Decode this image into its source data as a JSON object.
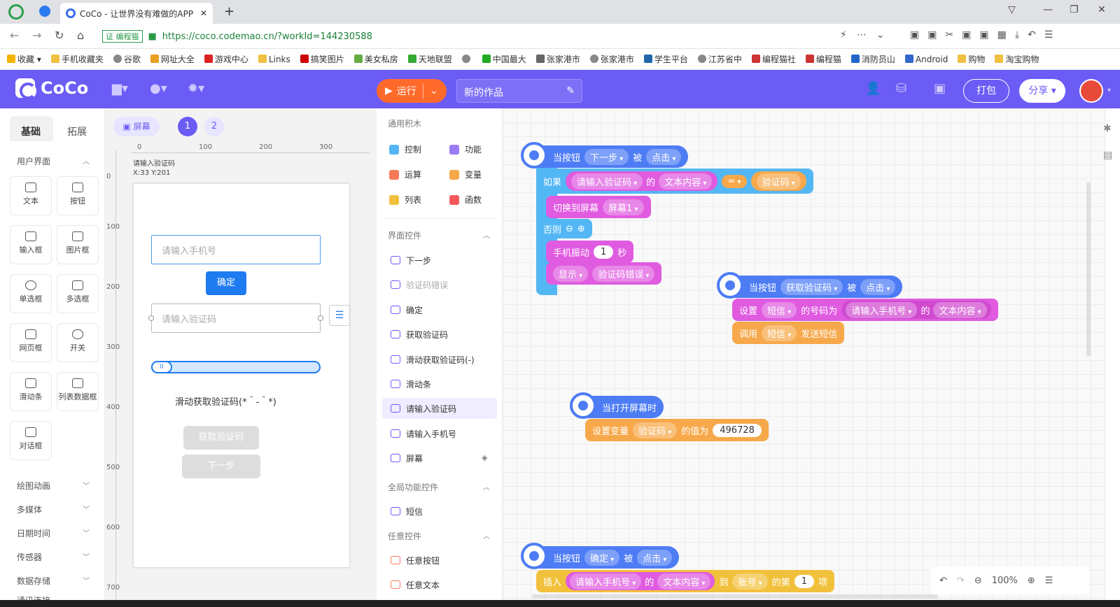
{
  "browser": {
    "tab_title": "CoCo - 让世界没有难做的APP",
    "url": "https://coco.codemao.cn/?workId=144230588",
    "url_badge": "证 编程猫",
    "bookmarks": [
      "收藏",
      "手机收藏夹",
      "谷歌",
      "网址大全",
      "游戏中心",
      "Links",
      "搞笑图片",
      "美女私房",
      "天地联盟",
      "",
      "中国最大",
      "张家港市",
      "张家港市",
      "学生平台",
      "江苏省中",
      "编程猫社",
      "编程猫",
      "消防员山",
      "Android",
      "购物",
      "淘宝购物"
    ]
  },
  "header": {
    "logo": "CoCo",
    "run_label": "运行",
    "work_name": "新的作品",
    "pack_label": "打包",
    "share_label": "分享"
  },
  "left": {
    "tabs": [
      "基础",
      "拓展"
    ],
    "section_ui": "用户界面",
    "components": [
      "文本",
      "按钮",
      "输入框",
      "图片框",
      "单选框",
      "多选框",
      "网页框",
      "开关",
      "滑动条",
      "列表数据框",
      "对话框"
    ],
    "sections": [
      "绘图动画",
      "多媒体",
      "日期时间",
      "传感器",
      "数据存储",
      "通讯连接"
    ]
  },
  "stage": {
    "screen_btn": "屏幕",
    "pages": [
      "1",
      "2"
    ],
    "ruler": [
      "0",
      "100",
      "200",
      "300"
    ],
    "vruler": [
      "0",
      "100",
      "200",
      "300",
      "400",
      "500",
      "600",
      "700"
    ],
    "selected_name": "请输入验证码",
    "coord": "X:33 Y:201",
    "phone_placeholder": "请输入手机号",
    "ok_label": "确定",
    "code_placeholder": "请输入验证码",
    "slider_label": "滑动获取验证码(*＾-＾*)",
    "get_code_label": "获取验证码",
    "next_label": "下一步"
  },
  "palette": {
    "title": "通用积木",
    "cats": [
      "控制",
      "功能",
      "运算",
      "变量",
      "列表",
      "函数"
    ],
    "ui_section": "界面控件",
    "ui_items": [
      "下一步",
      "验证码错误",
      "确定",
      "获取验证码",
      "滑动获取验证码(-)",
      "滑动条",
      "请输入验证码",
      "请输入手机号",
      "屏幕"
    ],
    "global_section": "全局功能控件",
    "global_items": [
      "短信"
    ],
    "any_section": "任意控件",
    "any_items": [
      "任意按钮",
      "任意文本"
    ]
  },
  "blocks": {
    "b1": {
      "when": "当按钮",
      "btn": "下一步",
      "is": "被",
      "event": "点击"
    },
    "b1_if": {
      "kw": "如果",
      "input": "请输入验证码",
      "of": "的",
      "prop": "文本内容",
      "op": "=",
      "var": "验证码"
    },
    "b1_switch": {
      "kw": "切换到屏幕",
      "screen": "屏幕1"
    },
    "b1_else": "否则",
    "b1_vibrate": {
      "kw": "手机振动",
      "val": "1",
      "unit": "秒"
    },
    "b1_show": {
      "kw": "显示",
      "target": "验证码错误"
    },
    "b2": {
      "when": "当按钮",
      "btn": "获取验证码",
      "is": "被",
      "event": "点击"
    },
    "b2_set": {
      "kw": "设置",
      "obj": "短信",
      "prop": "的号码为",
      "input": "请输入手机号",
      "of": "的",
      "val": "文本内容"
    },
    "b2_call": {
      "kw": "调用",
      "obj": "短信",
      "act": "发送短信"
    },
    "b3": {
      "when": "当打开屏幕时"
    },
    "b3_set": {
      "kw": "设置变量",
      "var": "验证码",
      "to": "的值为",
      "val": "496728"
    },
    "b4": {
      "when": "当按钮",
      "btn": "确定",
      "is": "被",
      "event": "点击"
    },
    "b4_insert": {
      "kw": "插入",
      "input": "请输入手机号",
      "of": "的",
      "prop": "文本内容",
      "to": "到",
      "list": "账号",
      "nth": "的第",
      "idx": "1",
      "item": "项"
    }
  },
  "zoom": "100%"
}
